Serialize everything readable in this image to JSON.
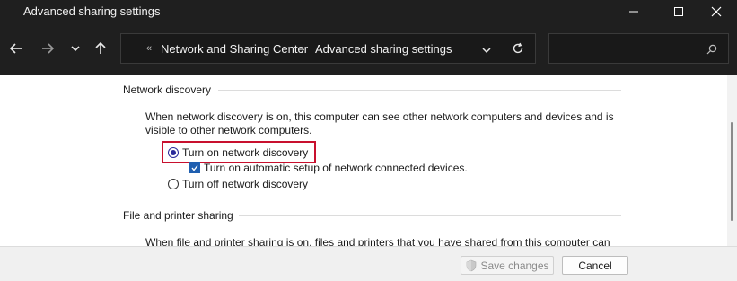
{
  "window": {
    "title": "Advanced sharing settings",
    "minimize_icon": "minimize-icon",
    "maximize_icon": "maximize-icon",
    "close_icon": "close-icon"
  },
  "navigation": {
    "back_icon": "arrow-left-icon",
    "forward_icon": "arrow-right-icon",
    "recent_icon": "chevron-down-icon",
    "up_icon": "arrow-up-icon",
    "breadcrumb_overflow": "«",
    "breadcrumb": [
      "Network and Sharing Center",
      "Advanced sharing settings"
    ],
    "separator": "›",
    "dropdown_icon": "chevron-down-icon",
    "refresh_icon": "refresh-icon",
    "search_placeholder": "",
    "search_icon": "search-icon"
  },
  "network_discovery": {
    "heading": "Network discovery",
    "description": "When network discovery is on, this computer can see other network computers and devices and is visible to other network computers.",
    "options": [
      {
        "label": "Turn on network discovery",
        "selected": true
      },
      {
        "label": "Turn off network discovery",
        "selected": false
      }
    ],
    "auto_setup": {
      "label": "Turn on automatic setup of network connected devices.",
      "checked": true
    }
  },
  "file_printer_sharing": {
    "heading": "File and printer sharing",
    "description": "When file and printer sharing is on, files and printers that you have shared from this computer can"
  },
  "footer": {
    "save_label": "Save changes",
    "save_icon": "shield-icon",
    "cancel_label": "Cancel"
  },
  "colors": {
    "titlebar": "#1f1f1f",
    "highlight_border": "#c8102e",
    "radio_selected": "#2b2b9a",
    "checkbox": "#1f5fb0"
  }
}
